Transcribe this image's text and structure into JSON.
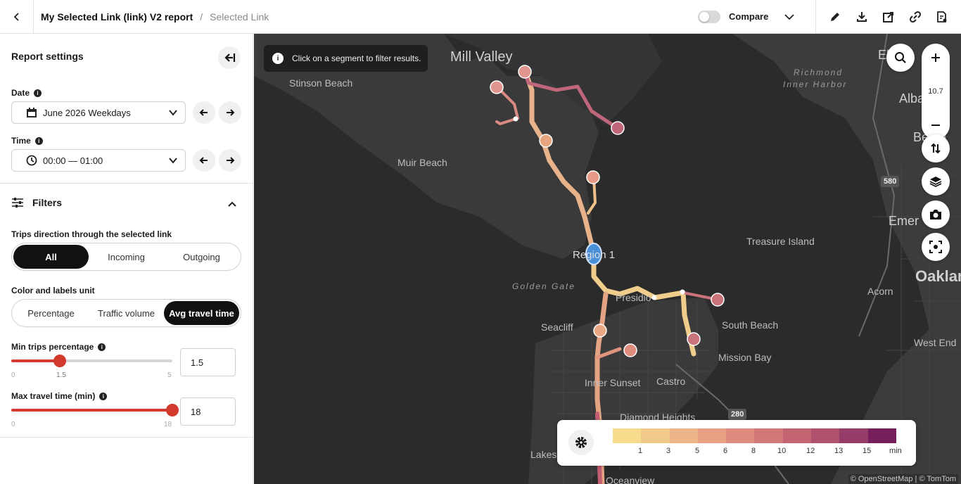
{
  "header": {
    "report_title": "My Selected Link (link) V2 report",
    "separator": "/",
    "current_page": "Selected Link",
    "compare_label": "Compare"
  },
  "sidebar": {
    "title": "Report settings",
    "date_label": "Date",
    "date_value": "June 2026 Weekdays",
    "time_label": "Time",
    "time_value": "00:00 — 01:00",
    "filters_label": "Filters",
    "direction_label": "Trips direction through the selected link",
    "direction_options": [
      "All",
      "Incoming",
      "Outgoing"
    ],
    "direction_selected": 0,
    "unit_label": "Color and labels unit",
    "unit_options": [
      "Percentage",
      "Traffic volume",
      "Avg travel time"
    ],
    "unit_selected": 2,
    "min_trips": {
      "label": "Min trips percentage",
      "min": "0",
      "max": "5",
      "value": "1.5",
      "fraction": 0.3
    },
    "max_time": {
      "label": "Max travel time (min)",
      "min": "0",
      "max": "18",
      "value": "18",
      "fraction": 1.0
    }
  },
  "map": {
    "toast": "Click on a segment to filter results.",
    "zoom_level": "10.7",
    "places": [
      "Mill Valley",
      "Stinson Beach",
      "Muir Beach",
      "Treasure Island",
      "Presidio",
      "Seacliff",
      "South Beach",
      "Mission Bay",
      "Inner Sunset",
      "Castro",
      "Diamond Heights",
      "Acorn",
      "West End",
      "Albany",
      "El C",
      "Emer",
      "Oaklan",
      "Berke",
      "Lakesh",
      "Oceanview"
    ],
    "water_labels": [
      "Golden Gate",
      "Richmond",
      "Inner Harbor"
    ],
    "region_label": "Region 1",
    "shields": [
      "580",
      "280"
    ],
    "attribution": "© OpenStreetMap | © TomTom"
  },
  "legend": {
    "colors": [
      "#f6dc8c",
      "#f1c98a",
      "#edb587",
      "#e7a083",
      "#df8b7e",
      "#d47779",
      "#c46473",
      "#b0516e",
      "#953c69",
      "#761f5c"
    ],
    "labels": [
      "1",
      "3",
      "5",
      "6",
      "8",
      "10",
      "12",
      "13",
      "15"
    ],
    "unit": "min"
  }
}
